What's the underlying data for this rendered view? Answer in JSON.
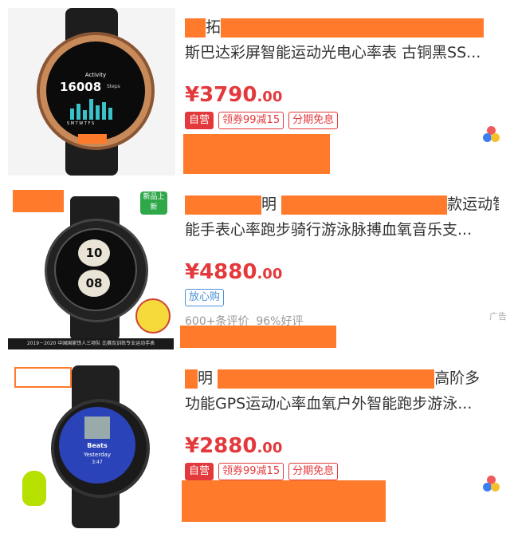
{
  "products": [
    {
      "title_prefix": "拓",
      "title_line2": "斯巴达彩屏智能运动光电心率表 古铜黑SS...",
      "price_main": "¥3790",
      "price_decimal": ".00",
      "tags": [
        "自营",
        "领券99减15",
        "分期免息"
      ],
      "watch_activity": "Activity",
      "watch_steps": "16008",
      "watch_steps_unit": "Steps",
      "watch_days": "S M T W T F S"
    },
    {
      "title_suffix_line1": "明",
      "title_tail_line1": "款运动智",
      "title_line2": "能手表心率跑步骑行游泳脉搏血氧音乐支...",
      "price_main": "¥4880",
      "price_decimal": ".00",
      "tags": [
        "放心购"
      ],
      "badge": "新品上新",
      "reviews": "600+条评价",
      "rating": "96%好评",
      "ad_label": "广告",
      "watch_top": "10",
      "watch_bottom": "08",
      "caption": "2019－2020 中国国家铁人三项队 比赛及训练专业运动手表"
    },
    {
      "title_prefix": "明",
      "title_tail_line1": "高阶多",
      "title_line2": "功能GPS运动心率血氧户外智能跑步游泳...",
      "price_main": "¥2880",
      "price_decimal": ".00",
      "tags": [
        "自营",
        "领券99减15",
        "分期免息"
      ],
      "watch_app": "Beats",
      "watch_sub": "Yesterday",
      "watch_time": "3:47"
    }
  ]
}
